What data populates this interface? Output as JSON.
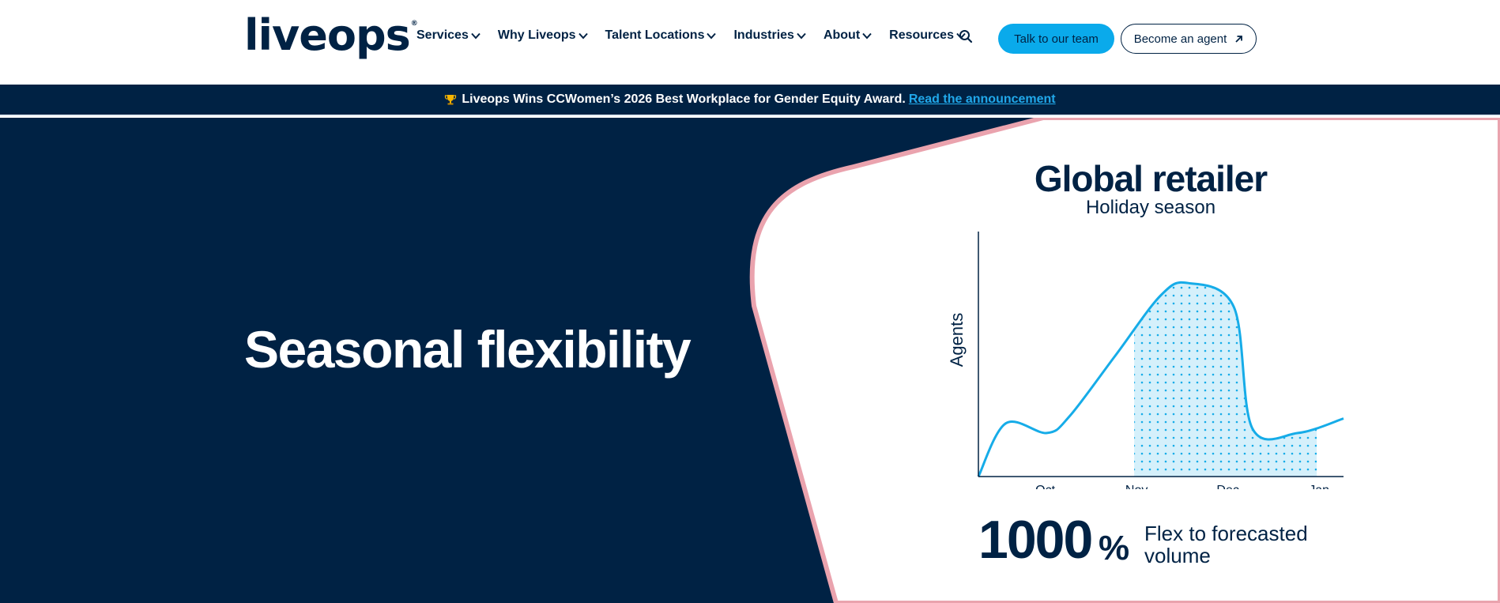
{
  "header": {
    "logo": "liveops",
    "logo_mark": "®",
    "nav": [
      {
        "label": "Services"
      },
      {
        "label": "Why Liveops"
      },
      {
        "label": "Talent Locations"
      },
      {
        "label": "Industries"
      },
      {
        "label": "About"
      },
      {
        "label": "Resources"
      }
    ],
    "search_icon": "search-icon",
    "cta_primary": "Talk to our team",
    "cta_secondary": "Become an agent"
  },
  "banner": {
    "icon": "trophy-icon",
    "text": "Liveops Wins CCWomen’s 2026 Best Workplace for Gender Equity Award.",
    "link": "Read the announcement"
  },
  "hero": {
    "title": "Seasonal flexibility"
  },
  "card": {
    "title": "Global retailer",
    "subtitle": "Holiday season",
    "stat_value": "1000",
    "stat_unit": "%",
    "stat_desc": "Flex to forecasted volume"
  },
  "chart_data": {
    "type": "area",
    "title": "Global retailer",
    "subtitle": "Holiday season",
    "ylabel": "Agents",
    "xlabel": "",
    "categories": [
      "Oct",
      "Nov",
      "Dec",
      "Jan"
    ],
    "x": [
      0,
      0.3,
      0.75,
      1.0,
      1.5,
      2.0,
      2.3,
      2.8,
      3.0,
      3.5,
      4.0
    ],
    "values": [
      0,
      22,
      18,
      25,
      50,
      75,
      80,
      70,
      20,
      18,
      24
    ],
    "highlight_range": [
      "Nov",
      "Jan"
    ],
    "ylim": [
      0,
      100
    ],
    "grid": false,
    "colors": {
      "line": "#16ace8",
      "fill": "#d5f0fb",
      "dots": "#16ace8",
      "axis": "#002244"
    }
  },
  "colors": {
    "navy": "#002244",
    "accent_blue": "#0aaaeb",
    "pink_border": "#eaa3ae",
    "link_blue": "#21a8ea"
  }
}
